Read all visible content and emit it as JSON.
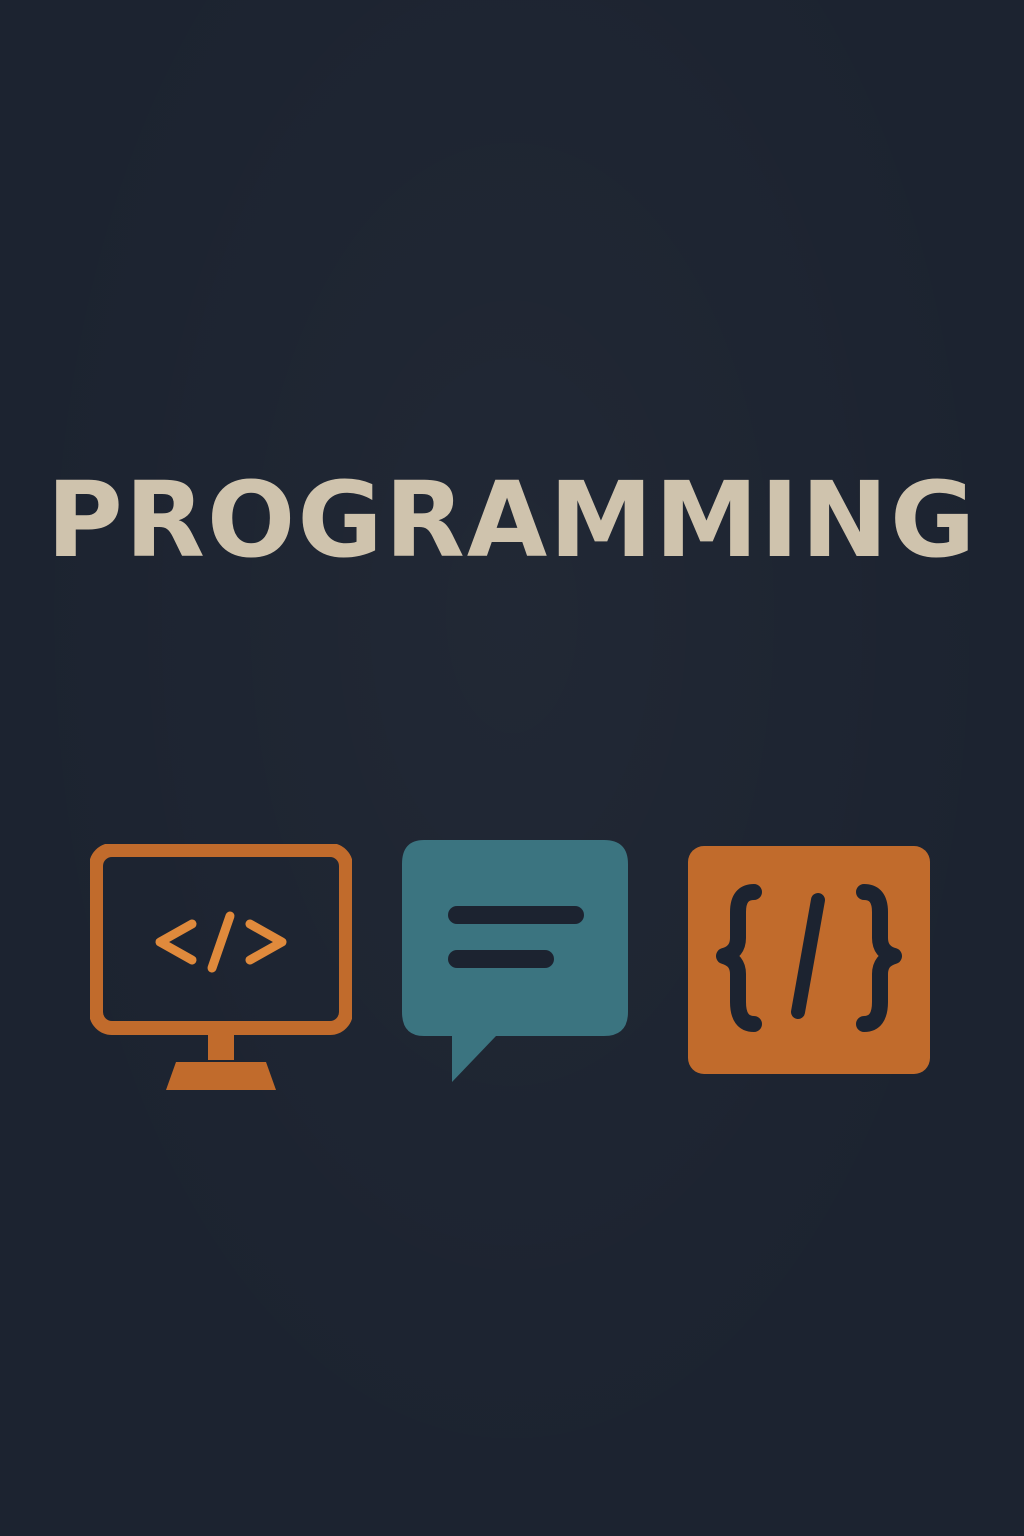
{
  "title": "PROGRAMMING",
  "colors": {
    "background": "#1c2330",
    "title": "#cfc3ad",
    "orange": "#c16b2c",
    "orange_light": "#e08a3c",
    "teal": "#3b7480"
  },
  "icons": [
    {
      "name": "monitor-code-icon",
      "glyph": "</>"
    },
    {
      "name": "chat-bubble-icon"
    },
    {
      "name": "code-braces-icon",
      "glyph": "{/}"
    }
  ]
}
